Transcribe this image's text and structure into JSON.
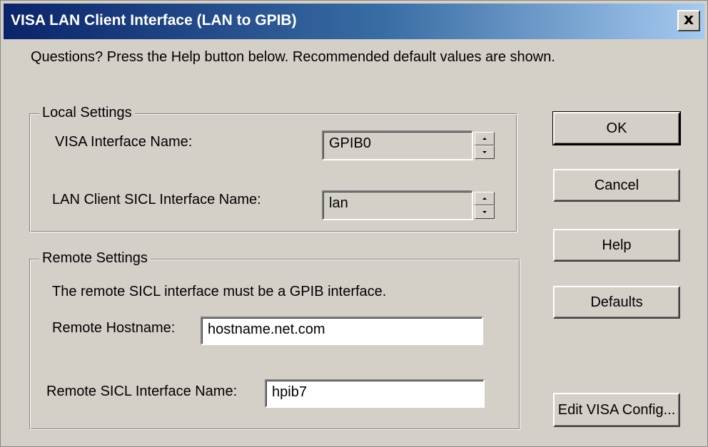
{
  "window": {
    "title": "VISA LAN Client Interface (LAN to GPIB)",
    "close_glyph": "x"
  },
  "intro_text": "Questions?  Press the Help button below.  Recommended default values are shown.",
  "local_settings": {
    "caption": "Local Settings",
    "visa_interface_label": "VISA Interface Name:",
    "visa_interface_value": "GPIB0",
    "lan_client_label": "LAN Client SICL Interface Name:",
    "lan_client_value": "lan"
  },
  "remote_settings": {
    "caption": "Remote Settings",
    "note": "The remote SICL interface must be a GPIB interface.",
    "hostname_label": "Remote Hostname:",
    "hostname_value": "hostname.net.com",
    "sicl_label": "Remote SICL Interface Name:",
    "sicl_value": "hpib7"
  },
  "buttons": {
    "ok": "OK",
    "cancel": "Cancel",
    "help": "Help",
    "defaults": "Defaults",
    "edit_visa_config": "Edit VISA Config..."
  }
}
